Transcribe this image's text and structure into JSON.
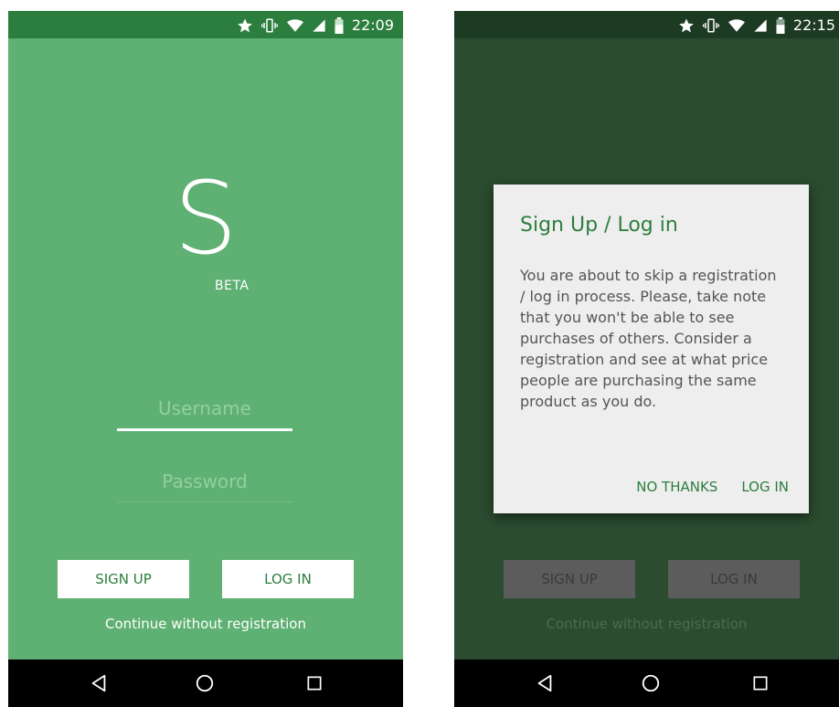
{
  "status_left": {
    "time": "22:09"
  },
  "status_right": {
    "time": "22:15"
  },
  "app": {
    "logo_letter": "S",
    "badge": "BETA"
  },
  "form": {
    "username_placeholder": "Username",
    "password_placeholder": "Password"
  },
  "buttons": {
    "signup": "SIGN UP",
    "login": "LOG IN",
    "continue": "Continue without registration"
  },
  "dialog": {
    "title": "Sign Up / Log in",
    "message": "You are about to skip a registration / log in process. Please, take note that you won't be able to see purchases of others. Consider a registration and see at what price people are purchasing the same product as you do.",
    "no_thanks": "NO THANKS",
    "login": "LOG IN"
  },
  "colors": {
    "primary": "#5eb073",
    "status_bar": "#2c7e3e",
    "dimmed_bg": "#2b4c30",
    "dialog_bg": "#eeeeee",
    "accent_text": "#2c7e3e"
  }
}
